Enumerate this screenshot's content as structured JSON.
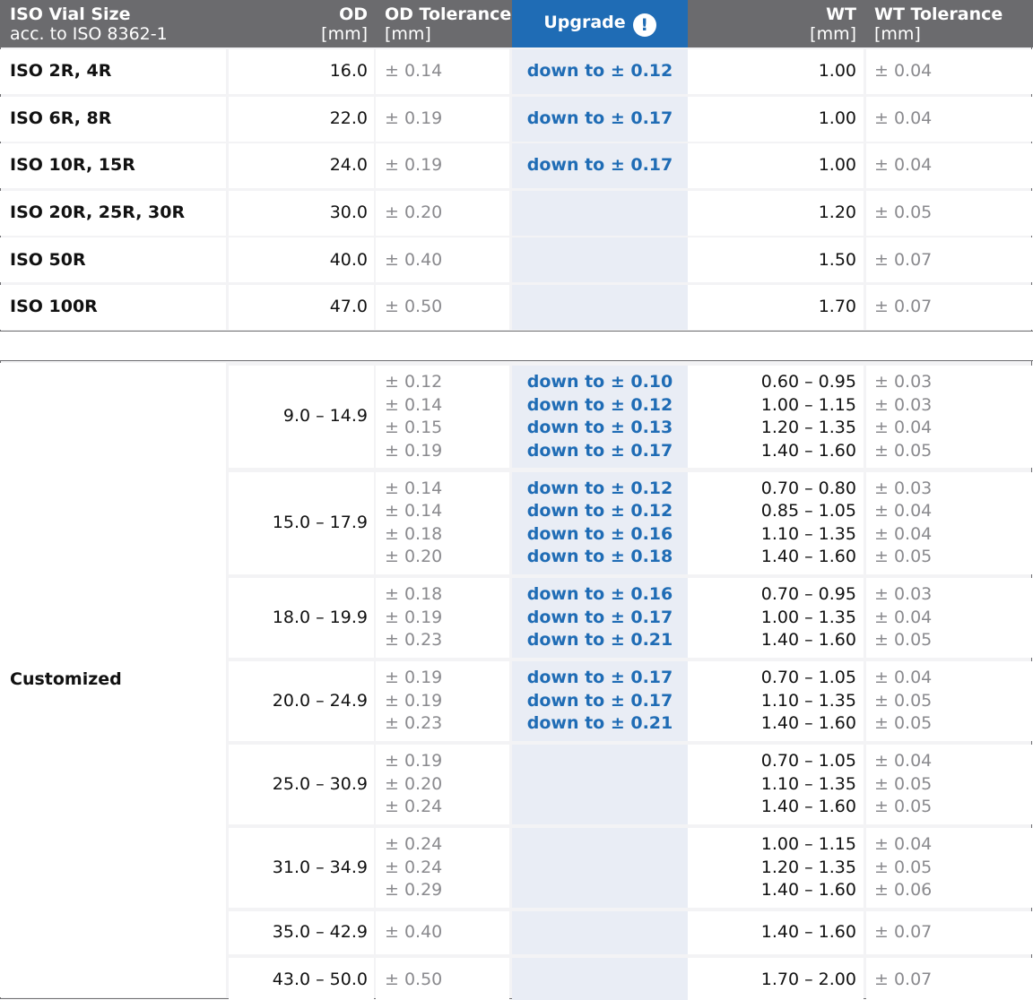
{
  "header": {
    "iso_title": "ISO Vial Size",
    "iso_subtitle": "acc. to ISO 8362-1",
    "od_title": "OD",
    "od_unit": "[mm]",
    "od_tol_title": "OD Tolerance",
    "od_tol_unit": "[mm]",
    "upgrade_label": "Upgrade",
    "upgrade_icon": "!",
    "wt_title": "WT",
    "wt_unit": "[mm]",
    "wt_tol_title": "WT Tolerance",
    "wt_tol_unit": "[mm]"
  },
  "iso_rows": [
    {
      "name": "ISO 2R, 4R",
      "od": "16.0",
      "od_tol": "± 0.14",
      "upgrade": "down to ± 0.12",
      "wt": "1.00",
      "wt_tol": "± 0.04"
    },
    {
      "name": "ISO 6R, 8R",
      "od": "22.0",
      "od_tol": "± 0.19",
      "upgrade": "down to ± 0.17",
      "wt": "1.00",
      "wt_tol": "± 0.04"
    },
    {
      "name": "ISO 10R, 15R",
      "od": "24.0",
      "od_tol": "± 0.19",
      "upgrade": "down to ± 0.17",
      "wt": "1.00",
      "wt_tol": "± 0.04"
    },
    {
      "name": "ISO 20R, 25R, 30R",
      "od": "30.0",
      "od_tol": "± 0.20",
      "upgrade": "",
      "wt": "1.20",
      "wt_tol": "± 0.05"
    },
    {
      "name": "ISO 50R",
      "od": "40.0",
      "od_tol": "± 0.40",
      "upgrade": "",
      "wt": "1.50",
      "wt_tol": "± 0.07"
    },
    {
      "name": "ISO 100R",
      "od": "47.0",
      "od_tol": "± 0.50",
      "upgrade": "",
      "wt": "1.70",
      "wt_tol": "± 0.07"
    }
  ],
  "custom_label": "Customized",
  "custom_groups": [
    {
      "od": "9.0 – 14.9",
      "lines": [
        {
          "od_tol": "± 0.12",
          "upgrade": "down to ± 0.10",
          "wt": "0.60 – 0.95",
          "wt_tol": "± 0.03"
        },
        {
          "od_tol": "± 0.14",
          "upgrade": "down to ± 0.12",
          "wt": "1.00 – 1.15",
          "wt_tol": "± 0.03"
        },
        {
          "od_tol": "± 0.15",
          "upgrade": "down to ± 0.13",
          "wt": "1.20 – 1.35",
          "wt_tol": "± 0.04"
        },
        {
          "od_tol": "± 0.19",
          "upgrade": "down to ± 0.17",
          "wt": "1.40 – 1.60",
          "wt_tol": "± 0.05"
        }
      ]
    },
    {
      "od": "15.0 – 17.9",
      "lines": [
        {
          "od_tol": "± 0.14",
          "upgrade": "down to ± 0.12",
          "wt": "0.70 – 0.80",
          "wt_tol": "± 0.03"
        },
        {
          "od_tol": "± 0.14",
          "upgrade": "down to ± 0.12",
          "wt": "0.85 – 1.05",
          "wt_tol": "± 0.04"
        },
        {
          "od_tol": "± 0.18",
          "upgrade": "down to ± 0.16",
          "wt": "1.10 – 1.35",
          "wt_tol": "± 0.04"
        },
        {
          "od_tol": "± 0.20",
          "upgrade": "down to ± 0.18",
          "wt": "1.40 – 1.60",
          "wt_tol": "± 0.05"
        }
      ]
    },
    {
      "od": "18.0 – 19.9",
      "lines": [
        {
          "od_tol": "± 0.18",
          "upgrade": "down to ± 0.16",
          "wt": "0.70 – 0.95",
          "wt_tol": "± 0.03"
        },
        {
          "od_tol": "± 0.19",
          "upgrade": "down to ± 0.17",
          "wt": "1.00 – 1.35",
          "wt_tol": "± 0.04"
        },
        {
          "od_tol": "± 0.23",
          "upgrade": "down to ± 0.21",
          "wt": "1.40 – 1.60",
          "wt_tol": "± 0.05"
        }
      ]
    },
    {
      "od": "20.0 – 24.9",
      "lines": [
        {
          "od_tol": "± 0.19",
          "upgrade": "down to ± 0.17",
          "wt": "0.70 – 1.05",
          "wt_tol": "± 0.04"
        },
        {
          "od_tol": "± 0.19",
          "upgrade": "down to ± 0.17",
          "wt": "1.10 – 1.35",
          "wt_tol": "± 0.05"
        },
        {
          "od_tol": "± 0.23",
          "upgrade": "down to ± 0.21",
          "wt": "1.40 – 1.60",
          "wt_tol": "± 0.05"
        }
      ]
    },
    {
      "od": "25.0 – 30.9",
      "lines": [
        {
          "od_tol": "± 0.19",
          "upgrade": "",
          "wt": "0.70 – 1.05",
          "wt_tol": "± 0.04"
        },
        {
          "od_tol": "± 0.20",
          "upgrade": "",
          "wt": "1.10 – 1.35",
          "wt_tol": "± 0.05"
        },
        {
          "od_tol": "± 0.24",
          "upgrade": "",
          "wt": "1.40 – 1.60",
          "wt_tol": "± 0.05"
        }
      ]
    },
    {
      "od": "31.0 – 34.9",
      "lines": [
        {
          "od_tol": "± 0.24",
          "upgrade": "",
          "wt": "1.00 – 1.15",
          "wt_tol": "± 0.04"
        },
        {
          "od_tol": "± 0.24",
          "upgrade": "",
          "wt": "1.20 – 1.35",
          "wt_tol": "± 0.05"
        },
        {
          "od_tol": "± 0.29",
          "upgrade": "",
          "wt": "1.40 – 1.60",
          "wt_tol": "± 0.06"
        }
      ]
    },
    {
      "od": "35.0 – 42.9",
      "lines": [
        {
          "od_tol": "± 0.40",
          "upgrade": "",
          "wt": "1.40 – 1.60",
          "wt_tol": "± 0.07"
        }
      ]
    },
    {
      "od": "43.0 – 50.0",
      "lines": [
        {
          "od_tol": "± 0.50",
          "upgrade": "",
          "wt": "1.70 – 2.00",
          "wt_tol": "± 0.07"
        }
      ]
    }
  ]
}
